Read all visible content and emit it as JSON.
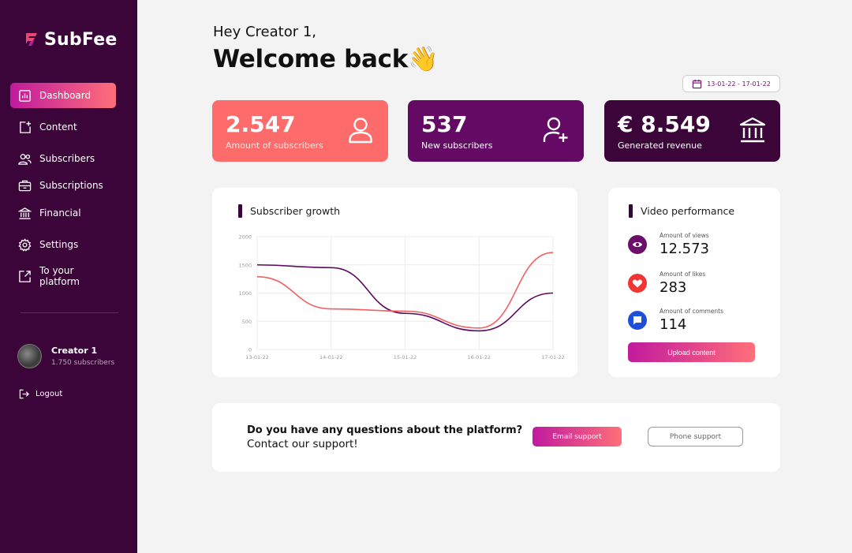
{
  "brand": {
    "prefix": "Sub",
    "suffix": "Fee",
    "accent": "#e8486f"
  },
  "sidebar": {
    "items": [
      {
        "label": "Dashboard",
        "icon": "bar-chart-icon",
        "active": true
      },
      {
        "label": "Content",
        "icon": "add-content-icon"
      },
      {
        "label": "Subscribers",
        "icon": "users-icon"
      },
      {
        "label": "Subscriptions",
        "icon": "briefcase-icon"
      },
      {
        "label": "Financial",
        "icon": "bank-icon"
      },
      {
        "label": "Settings",
        "icon": "gear-icon"
      },
      {
        "label": "To your platform",
        "icon": "external-link-icon"
      }
    ],
    "profile": {
      "name": "Creator 1",
      "subscribers": "1.750 subscribers"
    },
    "logout": "Logout"
  },
  "header": {
    "greeting": "Hey Creator 1,",
    "welcome": "Welcome back👋",
    "date_range": "13-01-22 - 17-01-22"
  },
  "stats": [
    {
      "value": "2.547",
      "label": "Amount of subscribers",
      "icon": "user-icon",
      "color": "#fd6c6a"
    },
    {
      "value": "537",
      "label": "New subscribers",
      "icon": "user-plus-icon",
      "color": "#640a65"
    },
    {
      "value": "€ 8.549",
      "label": "Generated revenue",
      "icon": "bank-icon",
      "color": "#3b0539"
    }
  ],
  "growth": {
    "title": "Subscriber growth"
  },
  "chart_data": {
    "type": "line",
    "categories": [
      "13-01-22",
      "14-01-22",
      "15-01-22",
      "16-01-22",
      "17-01-22"
    ],
    "ylim": [
      0,
      2000
    ],
    "yticks": [
      "2000",
      "1500",
      "1000",
      "500",
      "0"
    ],
    "series": [
      {
        "color": "#5c0a5e",
        "values": [
          1500,
          1450,
          640,
          330,
          1000
        ]
      },
      {
        "color": "#f2605f",
        "values": [
          1290,
          720,
          680,
          380,
          1720
        ]
      }
    ],
    "grid": true
  },
  "performance": {
    "title": "Video performance",
    "rows": [
      {
        "label": "Amount of views",
        "value": "12.573",
        "icon": "eye-icon",
        "color": "#6a0f6a"
      },
      {
        "label": "Amount of likes",
        "value": "283",
        "icon": "heart-icon",
        "color": "#f03535"
      },
      {
        "label": "Amount of comments",
        "value": "114",
        "icon": "comment-icon",
        "color": "#1d4fd8"
      }
    ],
    "upload": "Upload content"
  },
  "support": {
    "question": "Do you have any questions about the platform?",
    "cta": "Contact our support!",
    "email": "Email support",
    "phone": "Phone support"
  }
}
